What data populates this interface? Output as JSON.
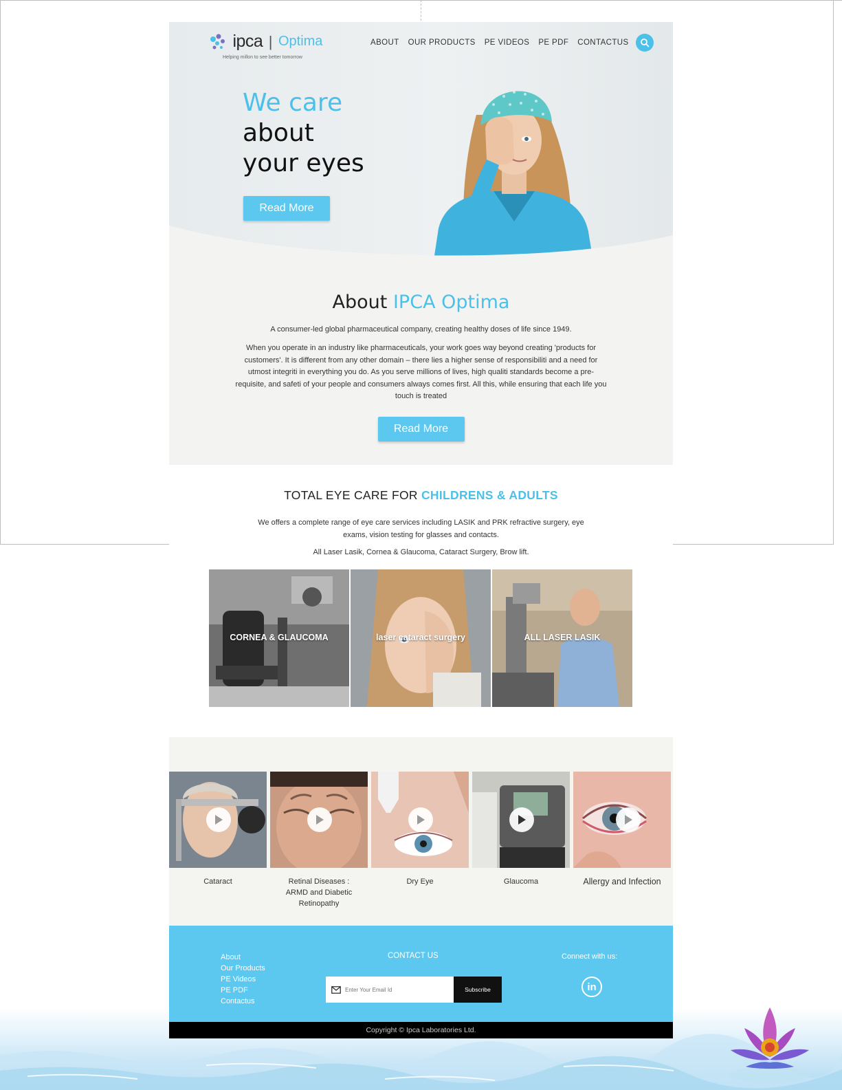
{
  "brand": {
    "name": "ipca",
    "product": "Optima",
    "tagline": "Helping millon to see better tomorrow"
  },
  "nav": {
    "items": [
      "ABOUT",
      "OUR PRODUCTS",
      "PE VIDEOS",
      "PE PDF",
      "CONTACTUS"
    ]
  },
  "hero": {
    "title_l1": "We care",
    "title_l2": "about",
    "title_l3": "your eyes",
    "button": "Read More"
  },
  "about": {
    "title_plain": "About ",
    "title_accent": "IPCA Optima",
    "lead": "A consumer-led global pharmaceutical company, creating healthy doses of life since 1949.",
    "body": "When you operate in an industry like pharmaceuticals, your work goes way beyond creating 'products for customers'. It is different from any other domain – there lies a higher sense of responsibiliti and a need for utmost integriti in everything you do. As you serve millions of lives, high qualiti standards become a pre-requisite, and safeti of your people and consumers always comes first. All this, while ensuring that each life you touch is treated",
    "button": "Read More"
  },
  "care": {
    "title_plain": "TOTAL EYE CARE FOR ",
    "title_accent": "CHILDRENS & ADULTS",
    "p1": "We offers a complete range of eye care services including LASIK and PRK refractive surgery, eye exams, vision testing for glasses and contacts.",
    "p2": "All Laser Lasik, Cornea & Glaucoma, Cataract Surgery, Brow lift.",
    "tiles": [
      "CORNEA & GLAUCOMA",
      "laser cataract surgery",
      "ALL LASER LASIK"
    ]
  },
  "videos": {
    "items": [
      {
        "label": "Cataract"
      },
      {
        "label": "Retinal Diseases : ARMD and Diabetic Retinopathy"
      },
      {
        "label": "Dry Eye"
      },
      {
        "label": "Glaucoma"
      },
      {
        "label": "Allergy and Infection"
      }
    ]
  },
  "footer": {
    "links": [
      "About",
      "Our Products",
      "PE Videos",
      "PE PDF",
      "Contactus"
    ],
    "contact_title": "CONTACT US",
    "email_placeholder": "Enter Your Email Id",
    "subscribe": "Subscribe",
    "connect_title": "Connect with us:",
    "linkedin": "in",
    "copyright": "Copyright © Ipca Laboratories Ltd."
  },
  "colors": {
    "accent": "#4cc0e8",
    "button": "#5cc8ef",
    "footer": "#5cc8ef",
    "copyright_bar": "#000000"
  },
  "icons": [
    "search-icon",
    "play-icon",
    "mail-icon",
    "linkedin-icon",
    "lotus-decoration"
  ]
}
